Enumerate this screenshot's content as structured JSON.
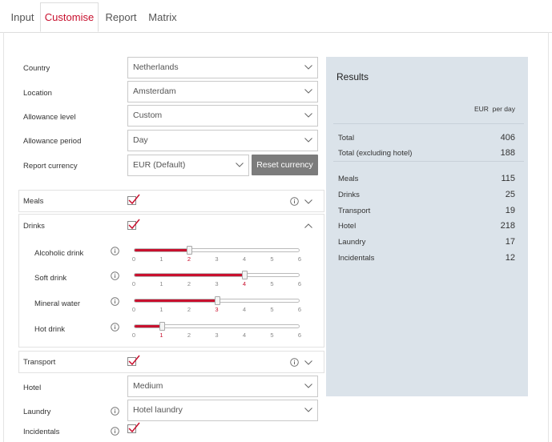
{
  "tabs": [
    "Input",
    "Customise",
    "Report",
    "Matrix"
  ],
  "fields": {
    "country": {
      "label": "Country",
      "value": "Netherlands"
    },
    "location": {
      "label": "Location",
      "value": "Amsterdam"
    },
    "allowance_level": {
      "label": "Allowance level",
      "value": "Custom"
    },
    "allowance_period": {
      "label": "Allowance period",
      "value": "Day"
    },
    "report_currency": {
      "label": "Report currency",
      "value": "EUR (Default)"
    },
    "reset_currency": "Reset currency"
  },
  "sections": {
    "meals": "Meals",
    "drinks": "Drinks",
    "transport": "Transport",
    "hotel": {
      "label": "Hotel",
      "value": "Medium"
    },
    "laundry": {
      "label": "Laundry",
      "value": "Hotel laundry"
    },
    "incidentals": "Incidentals"
  },
  "sliders": [
    {
      "label": "Alcoholic drink",
      "value": 2
    },
    {
      "label": "Soft drink",
      "value": 4
    },
    {
      "label": "Mineral water",
      "value": 3
    },
    {
      "label": "Hot drink",
      "value": 1
    }
  ],
  "slider_ticks": [
    "0",
    "1",
    "2",
    "3",
    "4",
    "5",
    "6"
  ],
  "results": {
    "title": "Results",
    "header": "EUR  per day",
    "total": {
      "label": "Total",
      "value": "406"
    },
    "total_excl": {
      "label": "Total (excluding hotel)",
      "value": "188"
    },
    "items": [
      {
        "label": "Meals",
        "value": "115"
      },
      {
        "label": "Drinks",
        "value": "25"
      },
      {
        "label": "Transport",
        "value": "19"
      },
      {
        "label": "Hotel",
        "value": "218"
      },
      {
        "label": "Laundry",
        "value": "17"
      },
      {
        "label": "Incidentals",
        "value": "12"
      }
    ]
  },
  "colors": {
    "accent": "#c8102e",
    "results_bg": "#dbe3ea",
    "button": "#7c7c7c"
  }
}
